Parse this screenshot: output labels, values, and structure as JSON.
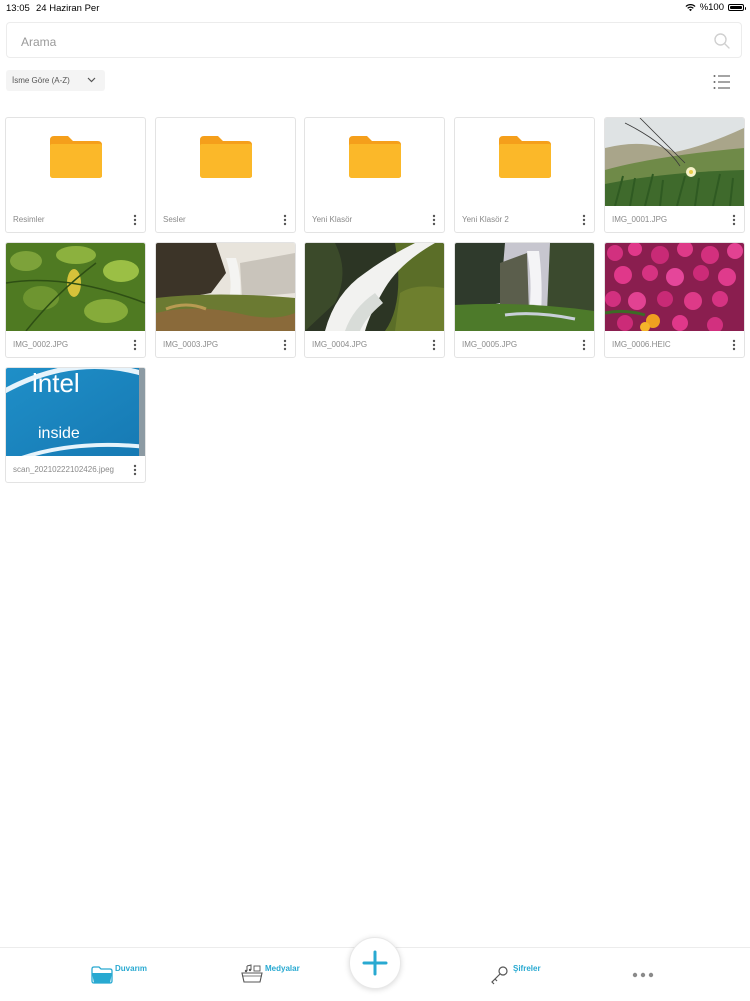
{
  "status_bar": {
    "time": "13:05",
    "date": "24 Haziran Per",
    "battery": "%100"
  },
  "search": {
    "placeholder": "Arama",
    "value": ""
  },
  "toolbar": {
    "sort_label": "İsme Göre (A-Z)"
  },
  "items": [
    {
      "type": "folder",
      "name": "Resimler"
    },
    {
      "type": "folder",
      "name": "Sesler"
    },
    {
      "type": "folder",
      "name": "Yeni Klasör"
    },
    {
      "type": "folder",
      "name": "Yeni Klasör 2"
    },
    {
      "type": "image",
      "name": "IMG_0001.JPG",
      "depicts": "dune-grass-flower"
    },
    {
      "type": "image",
      "name": "IMG_0002.JPG",
      "depicts": "green-leaves"
    },
    {
      "type": "image",
      "name": "IMG_0003.JPG",
      "depicts": "waterfall-mossy-rocks"
    },
    {
      "type": "image",
      "name": "IMG_0004.JPG",
      "depicts": "waterfall-closeup"
    },
    {
      "type": "image",
      "name": "IMG_0005.JPG",
      "depicts": "tall-waterfall-cliff"
    },
    {
      "type": "image",
      "name": "IMG_0006.HEIC",
      "depicts": "pink-flowers"
    },
    {
      "type": "image",
      "name": "scan_20210222102426.jpeg",
      "depicts": "intel-inside-logo",
      "logo_text": "intel inside"
    }
  ],
  "tab_bar": {
    "tabs": [
      {
        "label": "Duvarım",
        "icon": "folder-icon"
      },
      {
        "label": "Medyalar",
        "icon": "media-icon"
      },
      {
        "label": "Şifreler",
        "icon": "key-icon"
      }
    ],
    "more_icon": "more-horizontal-icon",
    "add_icon": "plus-icon"
  },
  "colors": {
    "accent": "#28a9d1",
    "folder": "#fbb829",
    "folder_dark": "#f59f1b"
  }
}
